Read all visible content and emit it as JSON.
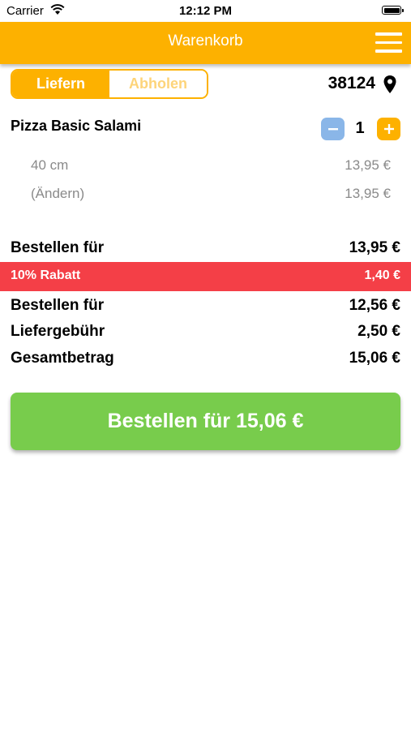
{
  "status_bar": {
    "carrier": "Carrier",
    "time": "12:12 PM"
  },
  "nav": {
    "title": "Warenkorb",
    "menu_icon": "hamburger-menu-icon"
  },
  "delivery_toggle": {
    "options": [
      "Liefern",
      "Abholen"
    ],
    "selected": "Liefern",
    "active_color": "#fdb100"
  },
  "location": {
    "zip": "38124",
    "icon": "location-pin-icon"
  },
  "cart": {
    "items": [
      {
        "name": "Pizza Basic Salami",
        "quantity": "1",
        "options": [
          {
            "label": "40 cm",
            "price": "13,95 €"
          },
          {
            "label": "(Ändern)",
            "price": "13,95 €"
          }
        ]
      }
    ]
  },
  "summary": {
    "subtotal_label": "Bestellen für",
    "subtotal_value": "13,95 €",
    "discount_label": "10% Rabatt",
    "discount_value": "1,40 €",
    "after_discount_label": "Bestellen für",
    "after_discount_value": "12,56 €",
    "delivery_fee_label": "Liefergebühr",
    "delivery_fee_value": "2,50 €",
    "total_label": "Gesamtbetrag",
    "total_value": "15,06 €"
  },
  "order_button": {
    "label": "Bestellen für 15,06 €",
    "color": "#78cc4c"
  },
  "colors": {
    "brand": "#fdb100",
    "discount": "#f43f47",
    "minus_button": "#8ab6e8"
  }
}
